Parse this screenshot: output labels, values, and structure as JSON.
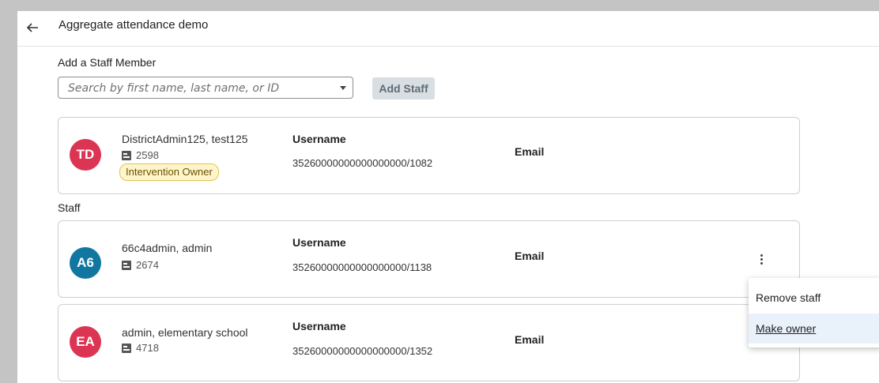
{
  "header": {
    "title": "Aggregate attendance demo",
    "back_icon": "arrow-left-icon"
  },
  "add_staff": {
    "label": "Add a Staff Member",
    "search_placeholder": "Search by first name, last name, or ID",
    "search_value": "",
    "button_label": "Add Staff"
  },
  "owner_card": {
    "initials": "TD",
    "avatar_color": "#dc3553",
    "name": "DistrictAdmin125, test125",
    "id": "2598",
    "badge": "Intervention Owner",
    "username_label": "Username",
    "username": "35260000000000000000/1082",
    "email_label": "Email",
    "email": ""
  },
  "staff_section": {
    "label": "Staff",
    "members": [
      {
        "initials": "A6",
        "avatar_color": "#1177a0",
        "name": "66c4admin, admin",
        "id": "2674",
        "username_label": "Username",
        "username": "35260000000000000000/1138",
        "email_label": "Email",
        "email": ""
      },
      {
        "initials": "EA",
        "avatar_color": "#dc3553",
        "name": "admin, elementary school",
        "id": "4718",
        "username_label": "Username",
        "username": "35260000000000000000/1352",
        "email_label": "Email",
        "email": ""
      }
    ]
  },
  "context_menu": {
    "items": [
      {
        "label": "Remove staff"
      },
      {
        "label": "Make owner"
      }
    ]
  }
}
